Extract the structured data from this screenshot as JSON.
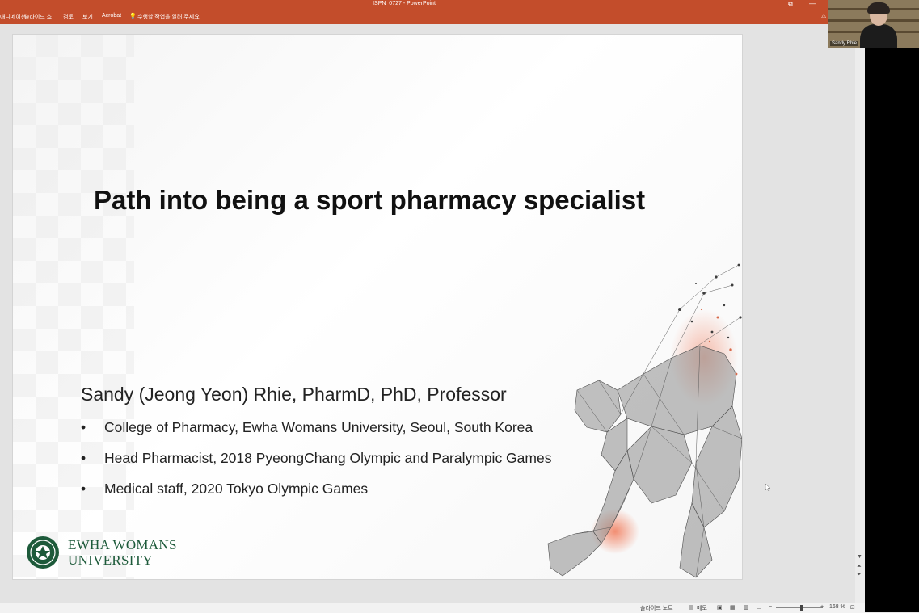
{
  "window": {
    "title": "ISPN_0727 - PowerPoint",
    "min_symbol": "—",
    "restore_symbol": "⧉",
    "ribbon_tabs": [
      "애니메이션",
      "슬라이드 쇼",
      "검토",
      "보기",
      "Acrobat",
      "수행할 작업을 알려 주세요."
    ]
  },
  "slide": {
    "title": "Path into being a sport pharmacy specialist",
    "author": "Sandy (Jeong Yeon) Rhie, PharmD, PhD, Professor",
    "bullets": [
      "College of Pharmacy, Ewha Womans University, Seoul, South Korea",
      "Head Pharmacist, 2018 PyeongChang Olympic and Paralympic Games",
      "Medical staff, 2020 Tokyo Olympic Games"
    ],
    "logo_line1": "EWHA WOMANS",
    "logo_line2": "UNIVERSITY"
  },
  "status_bar": {
    "notes_label": "슬라이드 노트",
    "comments_label": "메모",
    "zoom": "168 %"
  },
  "video": {
    "participant_name": "Sandy Rhie"
  },
  "colors": {
    "ribbon": "#c34d2b",
    "logo_green": "#1d5a3a"
  }
}
